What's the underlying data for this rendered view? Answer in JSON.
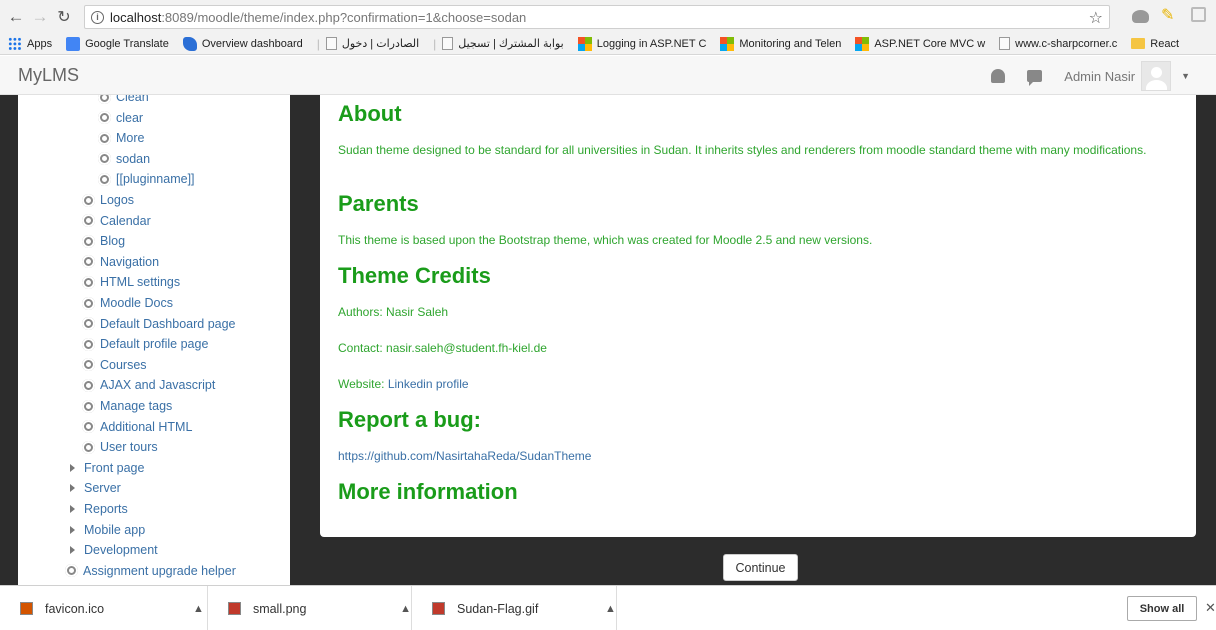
{
  "browser": {
    "url_host": "localhost",
    "url_path": ":8089/moodle/theme/index.php?confirmation=1&choose=sodan",
    "bookmarks": [
      {
        "label": "Apps",
        "icon": "apps-grid-icon"
      },
      {
        "label": "Google Translate",
        "icon": "google-translate-icon"
      },
      {
        "label": "Overview dashboard",
        "icon": "vsts-icon"
      },
      {
        "label": "الصادرات | دخول",
        "icon": "doc-icon"
      },
      {
        "label": "بوابة المشترك | تسجيل",
        "icon": "doc-icon"
      },
      {
        "label": "Logging in ASP.NET C",
        "icon": "microsoft-icon"
      },
      {
        "label": "Monitoring and Telen",
        "icon": "microsoft-icon"
      },
      {
        "label": "ASP.NET Core MVC w",
        "icon": "microsoft-icon"
      },
      {
        "label": "www.c-sharpcorner.c",
        "icon": "page-icon"
      },
      {
        "label": "React",
        "icon": "folder-icon"
      }
    ]
  },
  "navbar": {
    "brand": "MyLMS",
    "user_name": "Admin Nasir"
  },
  "sidebar": {
    "items": [
      {
        "label": "Clean",
        "type": "gear",
        "level": 2
      },
      {
        "label": "clear",
        "type": "gear",
        "level": 2
      },
      {
        "label": "More",
        "type": "gear",
        "level": 2
      },
      {
        "label": "sodan",
        "type": "gear",
        "level": 2
      },
      {
        "label": "[[pluginname]]",
        "type": "gear",
        "level": 2
      },
      {
        "label": "Logos",
        "type": "gear",
        "level": 1
      },
      {
        "label": "Calendar",
        "type": "gear",
        "level": 1
      },
      {
        "label": "Blog",
        "type": "gear",
        "level": 1
      },
      {
        "label": "Navigation",
        "type": "gear",
        "level": 1
      },
      {
        "label": "HTML settings",
        "type": "gear",
        "level": 1
      },
      {
        "label": "Moodle Docs",
        "type": "gear",
        "level": 1
      },
      {
        "label": "Default Dashboard page",
        "type": "gear",
        "level": 1
      },
      {
        "label": "Default profile page",
        "type": "gear",
        "level": 1
      },
      {
        "label": "Courses",
        "type": "gear",
        "level": 1
      },
      {
        "label": "AJAX and Javascript",
        "type": "gear",
        "level": 1
      },
      {
        "label": "Manage tags",
        "type": "gear",
        "level": 1
      },
      {
        "label": "Additional HTML",
        "type": "gear",
        "level": 1
      },
      {
        "label": "User tours",
        "type": "gear",
        "level": 1
      },
      {
        "label": "Front page",
        "type": "folder",
        "level": 0
      },
      {
        "label": "Server",
        "type": "folder",
        "level": 0
      },
      {
        "label": "Reports",
        "type": "folder",
        "level": 0
      },
      {
        "label": "Mobile app",
        "type": "folder",
        "level": 0
      },
      {
        "label": "Development",
        "type": "folder",
        "level": 0
      },
      {
        "label": "Assignment upgrade helper",
        "type": "gear",
        "level": 0
      }
    ]
  },
  "content": {
    "about_heading": "About",
    "about_text": "Sudan theme designed to be standard for all universities in Sudan. It inherits styles and renderers from moodle standard theme with many modifications.",
    "parents_heading": "Parents",
    "parents_text": "This theme is based upon the Bootstrap theme, which was created for Moodle 2.5 and new versions.",
    "credits_heading": "Theme Credits",
    "authors_text": "Authors: Nasir Saleh",
    "contact_prefix": "Contact: ",
    "contact_email": "nasir.saleh@student.fh-kiel.de",
    "website_prefix": "Website: ",
    "website_link": "Linkedin profile",
    "bug_heading": "Report a bug:",
    "bug_link": "https://github.com/NasirtahaReda/SudanTheme",
    "more_heading": "More information",
    "continue_label": "Continue"
  },
  "downloads": {
    "files": [
      "favicon.ico",
      "small.png",
      "Sudan-Flag.gif"
    ],
    "show_all_label": "Show all"
  },
  "colors": {
    "heading_green": "#1a9c1a",
    "text_green": "#2fa52f",
    "link_blue": "#3a70a6",
    "page_dark": "#2c2c2c"
  }
}
